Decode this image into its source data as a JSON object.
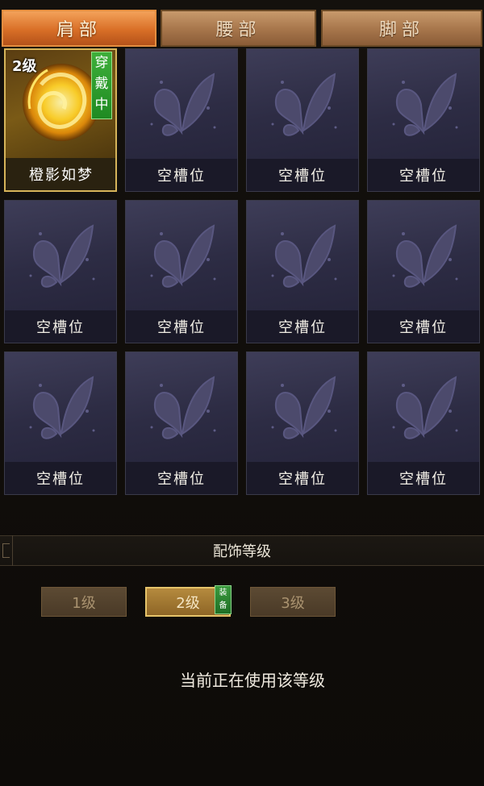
{
  "tabs": [
    {
      "label": "肩部",
      "active": true
    },
    {
      "label": "腰部",
      "active": false
    },
    {
      "label": "脚部",
      "active": false
    }
  ],
  "slots": [
    {
      "label": "橙影如梦",
      "level": "2级",
      "wearing": "穿戴中",
      "filled": true
    },
    {
      "label": "空槽位"
    },
    {
      "label": "空槽位"
    },
    {
      "label": "空槽位"
    },
    {
      "label": "空槽位"
    },
    {
      "label": "空槽位"
    },
    {
      "label": "空槽位"
    },
    {
      "label": "空槽位"
    },
    {
      "label": "空槽位"
    },
    {
      "label": "空槽位"
    },
    {
      "label": "空槽位"
    },
    {
      "label": "空槽位"
    }
  ],
  "section": {
    "title": "配饰等级"
  },
  "levels": [
    {
      "label": "1级",
      "active": false
    },
    {
      "label": "2级",
      "active": true,
      "badge": "装备"
    },
    {
      "label": "3级",
      "active": false
    }
  ],
  "status_text": "当前正在使用该等级",
  "colors": {
    "accent": "#e38d3f",
    "slot_bg": "#2d2c44",
    "equip_green": "#2a9a30"
  }
}
